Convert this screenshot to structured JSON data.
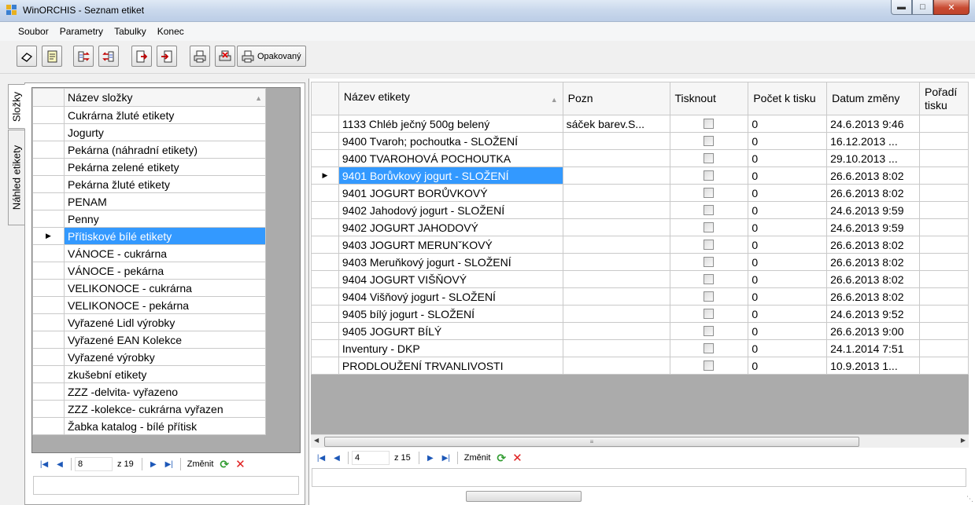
{
  "window": {
    "title": "WinORCHIS - Seznam etiket"
  },
  "menu": [
    "Soubor",
    "Parametry",
    "Tabulky",
    "Konec"
  ],
  "toolbar": {
    "repeat_label": "Opakovaný"
  },
  "tabs": {
    "folders": "Složky",
    "preview": "Náhled etikety"
  },
  "folders": {
    "header": "Název složky",
    "selected_index": 7,
    "items": [
      "Cukrárna žluté etikety",
      "Jogurty",
      "Pekárna  (náhradní  etikety)",
      "Pekárna zelené etikety",
      "Pekárna žluté etikety",
      "PENAM",
      "Penny",
      "Přítiskové bílé etikety",
      "VÁNOCE - cukrárna",
      "VÁNOCE - pekárna",
      "VELIKONOCE - cukrárna",
      "VELIKONOCE - pekárna",
      "Vyřazené  Lidl  výrobky",
      "Vyřazené EAN Kolekce",
      "Vyřazené výrobky",
      "zkušební etikety",
      "ZZZ -delvita- vyřazeno",
      "ZZZ -kolekce- cukrárna vyřazen",
      "Žabka katalog - bílé přítisk"
    ],
    "nav": {
      "position": "8",
      "count": "z 19",
      "change": "Změnit"
    }
  },
  "labels": {
    "headers": {
      "name": "Název etikety",
      "note": "Pozn",
      "print": "Tisknout",
      "count": "Počet k tisku",
      "date": "Datum změny",
      "order": "Pořadí tisku"
    },
    "selected_index": 3,
    "rows": [
      {
        "name": " 1133 Chléb ječný  500g  belený",
        "note": "sáček barev.S...",
        "count": "0",
        "date": "24.6.2013 9:46"
      },
      {
        "name": "9400 Tvaroh; pochoutka  - SLOŽENÍ",
        "note": "",
        "count": "0",
        "date": "16.12.2013 ..."
      },
      {
        "name": "9400 TVAROHOVÁ POCHOUTKA",
        "note": "",
        "count": "0",
        "date": "29.10.2013 ..."
      },
      {
        "name": "9401 Borůvkový jogurt - SLOŽENÍ",
        "note": "",
        "count": "0",
        "date": "26.6.2013 8:02"
      },
      {
        "name": "9401 JOGURT BORŮVKOVÝ",
        "note": "",
        "count": "0",
        "date": "26.6.2013 8:02"
      },
      {
        "name": "9402 Jahodový jogurt - SLOŽENÍ",
        "note": "",
        "count": "0",
        "date": "24.6.2013 9:59"
      },
      {
        "name": "9402 JOGURT JAHODOVÝ",
        "note": "",
        "count": "0",
        "date": "24.6.2013 9:59"
      },
      {
        "name": "9403 JOGURT MERUNˇKOVÝ",
        "note": "",
        "count": "0",
        "date": "26.6.2013 8:02"
      },
      {
        "name": "9403 Meruňkový jogurt - SLOŽENÍ",
        "note": "",
        "count": "0",
        "date": "26.6.2013 8:02"
      },
      {
        "name": "9404 JOGURT VIŠŇOVÝ",
        "note": "",
        "count": "0",
        "date": "26.6.2013 8:02"
      },
      {
        "name": "9404 Višňový jogurt - SLOŽENÍ",
        "note": "",
        "count": "0",
        "date": "26.6.2013 8:02"
      },
      {
        "name": "9405 bílý jogurt - SLOŽENÍ",
        "note": "",
        "count": "0",
        "date": "24.6.2013 9:52"
      },
      {
        "name": "9405 JOGURT BÍLÝ",
        "note": "",
        "count": "0",
        "date": "26.6.2013 9:00"
      },
      {
        "name": "Inventury - DKP",
        "note": "",
        "count": "0",
        "date": "24.1.2014 7:51"
      },
      {
        "name": "PRODLOUŽENÍ TRVANLIVOSTI",
        "note": "",
        "count": "0",
        "date": "10.9.2013 1..."
      }
    ],
    "nav": {
      "position": "4",
      "count": "z 15",
      "change": "Změnit"
    }
  }
}
